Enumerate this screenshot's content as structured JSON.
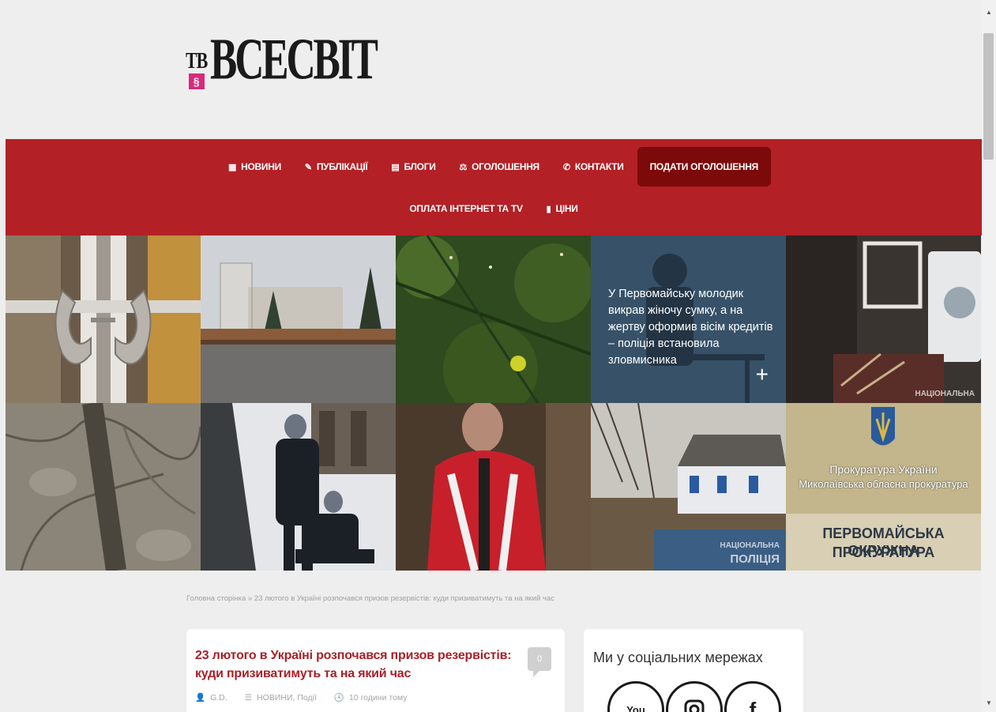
{
  "header": {
    "logo_prefix": "ТВ",
    "logo_word": "ВСЕСВІТ"
  },
  "nav": {
    "items": [
      {
        "label": "НОВИНИ",
        "icon": "calendar-icon",
        "glyph": "▦"
      },
      {
        "label": "ПУБЛІКАЦІЇ",
        "icon": "pencil-icon",
        "glyph": "✎"
      },
      {
        "label": "БЛОГИ",
        "icon": "book-icon",
        "glyph": "▤"
      },
      {
        "label": "ОГОЛОШЕННЯ",
        "icon": "gavel-icon",
        "glyph": "⚖"
      },
      {
        "label": "КОНТАКТИ",
        "icon": "phone-icon",
        "glyph": "✆"
      }
    ],
    "cta_label": "ПОДАТИ ОГОЛОШЕННЯ",
    "row2": [
      {
        "label": "ОПЛАТА ІНТЕРНЕТ ТА TV",
        "icon": "",
        "glyph": ""
      },
      {
        "label": "ЦІНИ",
        "icon": "bookmark-icon",
        "glyph": "▮"
      }
    ],
    "bg_color": "#b32025",
    "cta_color": "#7d0a0a"
  },
  "grid": {
    "featured_caption": "У Первомайську молодик викрав жіночу сумку, а на жертву оформив вісім кредитів – поліція встановила зловмисника",
    "plus": "+",
    "watermarks": {
      "national": "НАЦІОНАЛЬНА",
      "police_top": "НАЦІОНАЛЬНА",
      "police_bottom": "ПОЛІЦІЯ"
    },
    "sign": {
      "line1": "Прокуратура України",
      "line2": "Миколаївська обласна прокуратура",
      "line3": "ПЕРВОМАЙСЬКА ОКРУЖНА",
      "line4": "ПРОКУРАТУРА"
    }
  },
  "breadcrumb": "Головна сторінка » 23 лютого в Україні розпочався призов резервістів: куди призиватимуть та на який час",
  "post": {
    "title": "23 лютого в Україні розпочався призов резервістів: куди призиватимуть та на який час",
    "comments": "0",
    "author": "G.D.",
    "categories": "НОВИНИ, Події",
    "time": "10 години тому"
  },
  "sidebar": {
    "title": "Ми у соціальних мережах",
    "social": [
      {
        "icon": "youtube-icon",
        "label": "You"
      },
      {
        "icon": "instagram-icon",
        "label": ""
      },
      {
        "icon": "facebook-icon",
        "label": ""
      }
    ]
  }
}
